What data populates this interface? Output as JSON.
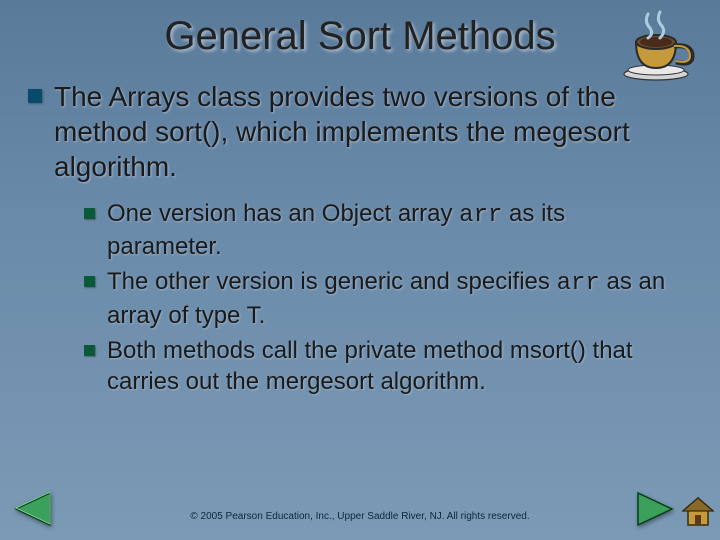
{
  "title": "General Sort Methods",
  "main_bullet": "The Arrays class provides two versions of the method sort(), which implements the megesort algorithm.",
  "sub": {
    "a_pre": "One version has an Object array ",
    "a_code": "arr",
    "a_post": " as its parameter.",
    "b_pre": "The other version is generic and specifies ",
    "b_code": "arr",
    "b_post": " as an array of type T.",
    "c": "Both methods call the private method msort() that carries out the mergesort algorithm."
  },
  "footer": "© 2005 Pearson Education, Inc., Upper Saddle River, NJ.  All rights reserved.",
  "icons": {
    "mug": "coffee-cup-icon",
    "prev": "prev-arrow-icon",
    "next": "next-arrow-icon",
    "home": "home-icon"
  },
  "colors": {
    "bullet1": "#0a4a6a",
    "bullet2": "#0a5a3a",
    "arrow": "#2a8a4a",
    "arrow_stroke": "#063a1a"
  }
}
